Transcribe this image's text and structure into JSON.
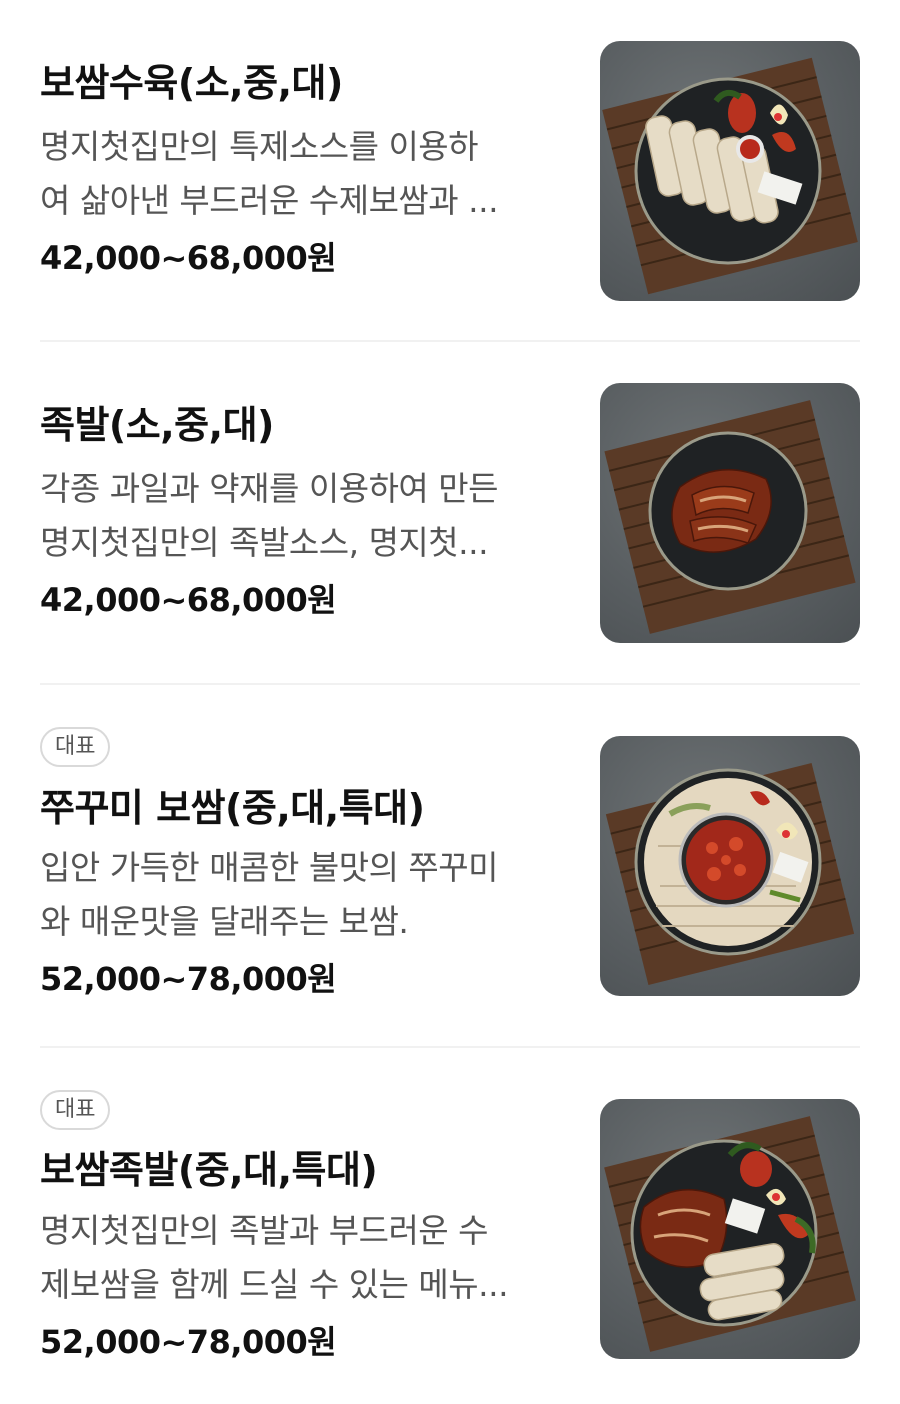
{
  "menu": {
    "items": [
      {
        "badge": "",
        "title": "보쌈수육(소,중,대)",
        "desc_line1": "명지첫집만의 특제소스를 이용하",
        "desc_line2": "여 삶아낸 부드러운 수제보쌈과 ...",
        "price": "42,000~68,000원",
        "photo_icon": "bossam-suyuk-photo-icon"
      },
      {
        "badge": "",
        "title": "족발(소,중,대)",
        "desc_line1": "각종 과일과 약재를 이용하여 만든",
        "desc_line2": "명지첫집만의 족발소스, 명지첫...",
        "price": "42,000~68,000원",
        "photo_icon": "jokbal-photo-icon"
      },
      {
        "badge": "대표",
        "title": "쭈꾸미 보쌈(중,대,특대)",
        "desc_line1": "입안 가득한 매콤한 불맛의 쭈꾸미",
        "desc_line2": "와 매운맛을 달래주는 보쌈.",
        "price": "52,000~78,000원",
        "photo_icon": "jjukkumi-bossam-photo-icon"
      },
      {
        "badge": "대표",
        "title": "보쌈족발(중,대,특대)",
        "desc_line1": "명지첫집만의 족발과 부드러운 수",
        "desc_line2": "제보쌈을 함께 드실 수 있는 메뉴...",
        "price": "52,000~78,000원",
        "photo_icon": "bossam-jokbal-photo-icon"
      }
    ]
  },
  "colors": {
    "title": "#111111",
    "description": "#555555",
    "divider": "#f1f1f1",
    "badge_border": "#d9d9d9",
    "photo_background": "#5a5f62"
  }
}
